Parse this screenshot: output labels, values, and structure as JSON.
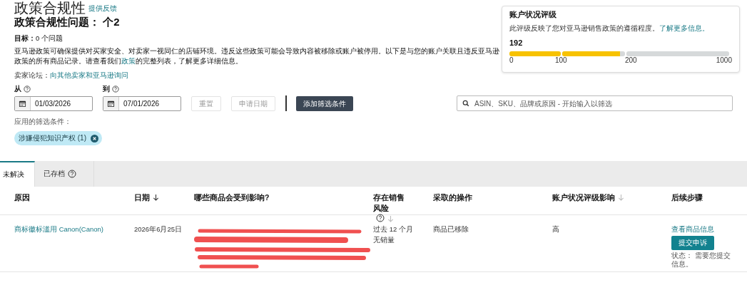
{
  "page_title": "政策合规性",
  "feedback_link": "提供反馈",
  "issue_count": "政策合规性问题： 个2",
  "target": {
    "label": "目标：",
    "value": "0 个问题"
  },
  "description": {
    "before": "亚马逊政策可确保提供对买家安全、对卖家一视同仁的店铺环境。违反这些政策可能会导致内容被移除或账户被停用。以下是与您的账户关联且违反亚马逊政策的所有商品记录。请查看我们",
    "link": "政策",
    "after": "的完整列表，了解更多详细信息。"
  },
  "forum": {
    "label": "卖家论坛：",
    "link": "向其他卖家和亚马逊询问"
  },
  "rating_card": {
    "title": "账户状况评级",
    "text": "此评级反映了您对亚马逊销售政策的遵循程度。",
    "link": "了解更多信息。",
    "score": "192",
    "segments": [
      {
        "level": 1
      },
      {
        "level": 0.92
      },
      {
        "level": 0
      }
    ],
    "ticks": [
      "0",
      "100",
      "200",
      "1000"
    ]
  },
  "filters": {
    "from_label": "从",
    "from_value": "01/03/2026",
    "to_label": "到",
    "to_value": "07/01/2026",
    "reset": "重置",
    "date_button": "申请日期",
    "add_filter": "添加筛选条件",
    "search_placeholder": "ASIN、SKU、品牌或原因 - 开始输入以筛选",
    "applied_label": "应用的筛选条件：",
    "chips": [
      "涉嫌侵犯知识产权 (1)"
    ]
  },
  "tabs": [
    {
      "label": "未解决",
      "selected": true,
      "help": false
    },
    {
      "label": "已存档",
      "selected": false,
      "help": true
    }
  ],
  "table": {
    "columns": [
      {
        "label": "原因",
        "sortable": false,
        "help": false
      },
      {
        "label": "日期",
        "sortable": true,
        "sort_active": true,
        "help": false
      },
      {
        "label": "哪些商品会受到影响?",
        "sortable": false,
        "help": false
      },
      {
        "label": "存在销售风险",
        "sortable": true,
        "sort_active": false,
        "help": true
      },
      {
        "label": "采取的操作",
        "sortable": false,
        "help": false
      },
      {
        "label": "账户状况评级影响",
        "sortable": true,
        "sort_active": false,
        "help": false
      },
      {
        "label": "后续步骤",
        "sortable": false,
        "help": false
      }
    ],
    "rows": [
      {
        "reason": "商标徽标滥用 Canon(Canon)",
        "date": "2026年6月25日",
        "products_redacted": true,
        "risk": "过去 12 个月无销量",
        "action": "商品已移除",
        "impact": "高",
        "view_link": "查看商品信息",
        "appeal_button": "提交申诉",
        "status": "状态： 需要您提交信息。"
      }
    ]
  }
}
